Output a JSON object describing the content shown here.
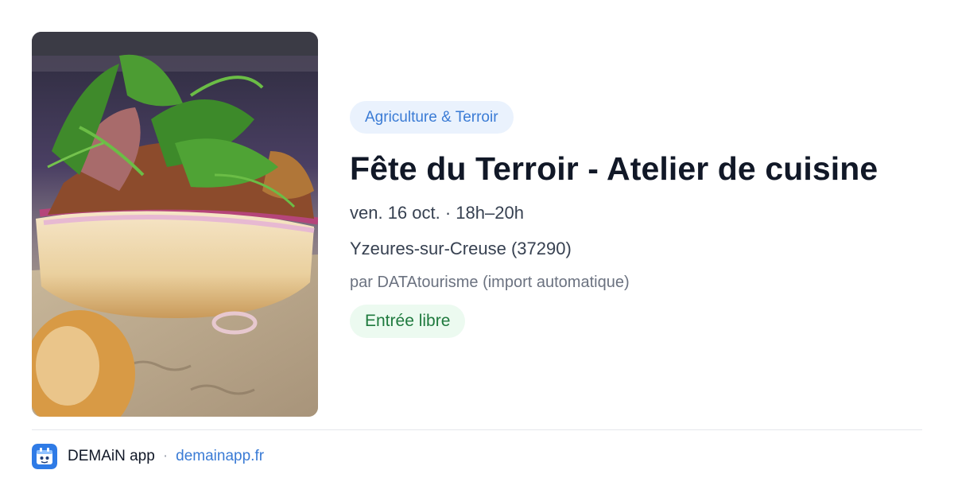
{
  "event": {
    "image_alt": "sandwich-photo",
    "category": "Agriculture & Terroir",
    "title": "Fête du Terroir - Atelier de cuisine",
    "datetime": "ven. 16 oct. · 18h–20h",
    "location": "Yzeures-sur-Creuse (37290)",
    "organizer": "par DATAtourisme (import automatique)",
    "price": "Entrée libre"
  },
  "footer": {
    "app_icon": "demain-app-logo-icon",
    "app_name": "DEMAiN app",
    "separator": "·",
    "link_text": "demainapp.fr"
  },
  "colors": {
    "accent_blue": "#3a7bd5",
    "category_badge_bg": "#eaf2fd",
    "price_badge_bg": "#ecfaf0",
    "price_text": "#1f7a3e",
    "title_text": "#111827",
    "secondary_text": "#374151",
    "muted_text": "#6b7280"
  }
}
